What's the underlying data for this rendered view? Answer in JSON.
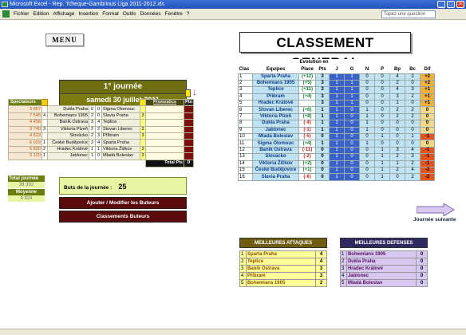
{
  "window": {
    "title": "Microsoft Excel - Rep. Tcheque-Gambrinus Liga 2011-2012.xls"
  },
  "menubar": {
    "items": [
      "Fichier",
      "Edition",
      "Affichage",
      "Insertion",
      "Format",
      "Outils",
      "Données",
      "Fenêtre",
      "?"
    ],
    "question_placeholder": "Tapez une question"
  },
  "sheet": {
    "menu_label": "MENU",
    "classement_title": "CLASSEMENT GENERAL",
    "journee": {
      "title": "1° journée",
      "date": "samedi 30 juillet 2011"
    },
    "match_headers": {
      "spectateurs": "Spectateurs",
      "pronostics": "Pronostics",
      "pts": "Pts",
      "total_pts": "Total Pts",
      "total_pts_value": "0"
    },
    "matches": [
      {
        "spec": "3 857",
        "flag": "",
        "home": "Dukla Praha",
        "hs": "0",
        "as": "0",
        "away": "Sigma Olomouc",
        "pr": ""
      },
      {
        "spec": "7 545",
        "flag": "4",
        "home": "Bohemians 1905",
        "hs": "2",
        "as": "0",
        "away": "Slavia Praha",
        "pr": "3"
      },
      {
        "spec": "4 458",
        "flag": "",
        "home": "Baník Ostrava",
        "hs": "3",
        "as": "4",
        "away": "Teplice",
        "pr": ""
      },
      {
        "spec": "3 740",
        "flag": "3",
        "home": "Viktoria Plzeň",
        "hs": "2",
        "as": "2",
        "away": "Slovan Liberec",
        "pr": "3"
      },
      {
        "spec": "4 823",
        "flag": "",
        "home": "Slovácko",
        "hs": "2",
        "as": "3",
        "away": "Příbram",
        "pr": "3"
      },
      {
        "spec": "6 029",
        "flag": "1",
        "home": "České Budějovice",
        "hs": "2",
        "as": "4",
        "away": "Sparta Praha",
        "pr": ""
      },
      {
        "spec": "5 820",
        "flag": "2",
        "home": "Hradec Králové",
        "hs": "1",
        "as": "1",
        "away": "Viktoria Žižkov",
        "pr": "3"
      },
      {
        "spec": "3 120",
        "flag": "1",
        "home": "Jablonec",
        "hs": "1",
        "as": "0",
        "away": "Mladá Boleslav",
        "pr": "3"
      }
    ],
    "totals": {
      "total_label": "Total journée",
      "total_value": "39 392",
      "moy_label": "Moyenne",
      "moy_value": "4 924"
    },
    "buts": {
      "label": "Buts de la journée :",
      "value": "25"
    },
    "buttons": {
      "ajouter": "Ajouter / Modifier les Buteurs",
      "classements": "Classements Buteurs"
    },
    "ranking_headers": {
      "evo_top": "Evolution en",
      "clas": "Clas",
      "equipes": "Equipes",
      "place": "Place",
      "pts": "Pts",
      "j": "J",
      "g": "G",
      "n": "N",
      "p": "P",
      "bp": "Bp",
      "bc": "Bc",
      "dif": "Dif"
    },
    "ranking": [
      {
        "pos": "1",
        "team": "Sparta Praha",
        "evo": "(+12)",
        "pts": "3",
        "j": "1",
        "g": "1",
        "n": "0",
        "p": "0",
        "bp": "4",
        "bc": "2",
        "dif": "+2"
      },
      {
        "pos": "2",
        "team": "Bohemians 1905",
        "evo": "(+5)",
        "pts": "3",
        "j": "1",
        "g": "1",
        "n": "0",
        "p": "0",
        "bp": "2",
        "bc": "0",
        "dif": "+2"
      },
      {
        "pos": "3",
        "team": "Teplice",
        "evo": "(+11)",
        "pts": "3",
        "j": "1",
        "g": "1",
        "n": "0",
        "p": "0",
        "bp": "4",
        "bc": "3",
        "dif": "+1"
      },
      {
        "pos": "4",
        "team": "Příbram",
        "evo": "(+4)",
        "pts": "3",
        "j": "1",
        "g": "1",
        "n": "0",
        "p": "0",
        "bp": "3",
        "bc": "2",
        "dif": "+1"
      },
      {
        "pos": "5",
        "team": "Hradec Králové",
        "evo": "",
        "pts": "3",
        "j": "1",
        "g": "1",
        "n": "0",
        "p": "0",
        "bp": "1",
        "bc": "0",
        "dif": "+1"
      },
      {
        "pos": "6",
        "team": "Slovan Liberec",
        "evo": "(+6)",
        "pts": "1",
        "j": "1",
        "g": "0",
        "n": "1",
        "p": "0",
        "bp": "2",
        "bc": "2",
        "dif": "0"
      },
      {
        "pos": "7",
        "team": "Viktoria Plzeň",
        "evo": "(+8)",
        "pts": "1",
        "j": "1",
        "g": "0",
        "n": "1",
        "p": "0",
        "bp": "2",
        "bc": "2",
        "dif": "0"
      },
      {
        "pos": "8",
        "team": "Dukla Praha",
        "evo": "(-4)",
        "pts": "1",
        "j": "1",
        "g": "0",
        "n": "1",
        "p": "0",
        "bp": "0",
        "bc": "0",
        "dif": "0"
      },
      {
        "pos": "9",
        "team": "Jablonec",
        "evo": "(-1)",
        "pts": "1",
        "j": "1",
        "g": "0",
        "n": "1",
        "p": "0",
        "bp": "0",
        "bc": "0",
        "dif": "0"
      },
      {
        "pos": "10",
        "team": "Mladá Boleslav",
        "evo": "(-5)",
        "pts": "0",
        "j": "1",
        "g": "0",
        "n": "0",
        "p": "1",
        "bp": "0",
        "bc": "1",
        "dif": "-1"
      },
      {
        "pos": "11",
        "team": "Sigma Olomouc",
        "evo": "(+4)",
        "pts": "1",
        "j": "1",
        "g": "0",
        "n": "1",
        "p": "0",
        "bp": "0",
        "bc": "0",
        "dif": "0"
      },
      {
        "pos": "12",
        "team": "Baník Ostrava",
        "evo": "(-11)",
        "pts": "0",
        "j": "1",
        "g": "0",
        "n": "0",
        "p": "1",
        "bp": "3",
        "bc": "4",
        "dif": "-1"
      },
      {
        "pos": "13",
        "team": "Slovácko",
        "evo": "(-2)",
        "pts": "0",
        "j": "1",
        "g": "0",
        "n": "0",
        "p": "1",
        "bp": "2",
        "bc": "3",
        "dif": "-1"
      },
      {
        "pos": "14",
        "team": "Viktoria Žižkov",
        "evo": "(+2)",
        "pts": "0",
        "j": "1",
        "g": "0",
        "n": "0",
        "p": "1",
        "bp": "1",
        "bc": "2",
        "dif": "-1"
      },
      {
        "pos": "15",
        "team": "České Budějovice",
        "evo": "(+1)",
        "pts": "0",
        "j": "1",
        "g": "0",
        "n": "0",
        "p": "1",
        "bp": "2",
        "bc": "4",
        "dif": "-2"
      },
      {
        "pos": "16",
        "team": "Slavia Praha",
        "evo": "(-6)",
        "pts": "0",
        "j": "1",
        "g": "0",
        "n": "0",
        "p": "1",
        "bp": "0",
        "bc": "2",
        "dif": "-2"
      }
    ],
    "journee_suivante": "Journée suivante",
    "attaques": {
      "title": "MEILLEURES ATTAQUES",
      "rows": [
        {
          "n": "1",
          "team": "Sparta Praha",
          "v": "4"
        },
        {
          "n": "2",
          "team": "Teplice",
          "v": "4"
        },
        {
          "n": "3",
          "team": "Baník Ostrava",
          "v": "3"
        },
        {
          "n": "4",
          "team": "Příbram",
          "v": "3"
        },
        {
          "n": "5",
          "team": "Bohemians 1905",
          "v": "2"
        }
      ]
    },
    "defenses": {
      "title": "MEILLEURES DEFENSES",
      "rows": [
        {
          "n": "1",
          "team": "Bohemians 1905",
          "v": "0"
        },
        {
          "n": "2",
          "team": "Dukla Praha",
          "v": "0"
        },
        {
          "n": "3",
          "team": "Hradec Králové",
          "v": "0"
        },
        {
          "n": "4",
          "team": "Jablonec",
          "v": "0"
        },
        {
          "n": "5",
          "team": "Mladá Boleslav",
          "v": "0"
        }
      ]
    }
  },
  "colors": {
    "evo_pos": "#0a7a2a",
    "evo_neg": "#c0281a",
    "dif_pos": "#f3b03a",
    "dif_zero": "#f5d78a",
    "dif_neg": "#e2551f",
    "rank_cell": "#bfe3f2",
    "rank_blue": "#3a62c8"
  }
}
